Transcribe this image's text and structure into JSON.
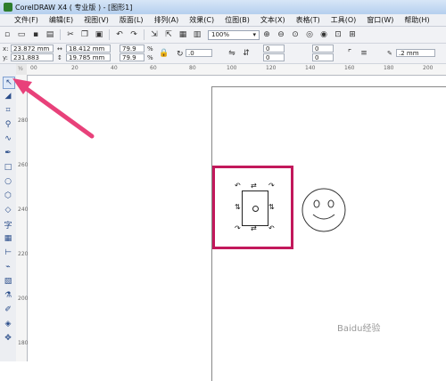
{
  "window": {
    "title": "CorelDRAW X4 ( 专业版 ) - [图形1]"
  },
  "menu": [
    "文件(F)",
    "编辑(E)",
    "视图(V)",
    "版面(L)",
    "排列(A)",
    "效果(C)",
    "位图(B)",
    "文本(X)",
    "表格(T)",
    "工具(O)",
    "窗口(W)",
    "帮助(H)"
  ],
  "toolbar": {
    "zoom": "100%"
  },
  "property_bar": {
    "x_label": "x:",
    "x_value": "23.872 mm",
    "y_label": "y:",
    "y_value": "231.883 mm",
    "w_value": "18.412 mm",
    "h_value": "19.785 mm",
    "scale_w": "79.9",
    "scale_h": "79.9",
    "percent": "%",
    "angle": ".0",
    "val1": "0",
    "val2": "0",
    "val3": "0",
    "val4": "0",
    "outline_width": ".2 mm"
  },
  "ruler": {
    "unit": "毫米",
    "h_ticks": [
      "00",
      "20",
      "40",
      "60",
      "80",
      "100",
      "120",
      "140",
      "160",
      "180",
      "200"
    ],
    "v_ticks": [
      "280",
      "260",
      "240",
      "220",
      "200",
      "180"
    ]
  },
  "watermark": "Baidu经验",
  "colors": {
    "highlight": "#c2185b",
    "arrow": "#e8417a"
  }
}
